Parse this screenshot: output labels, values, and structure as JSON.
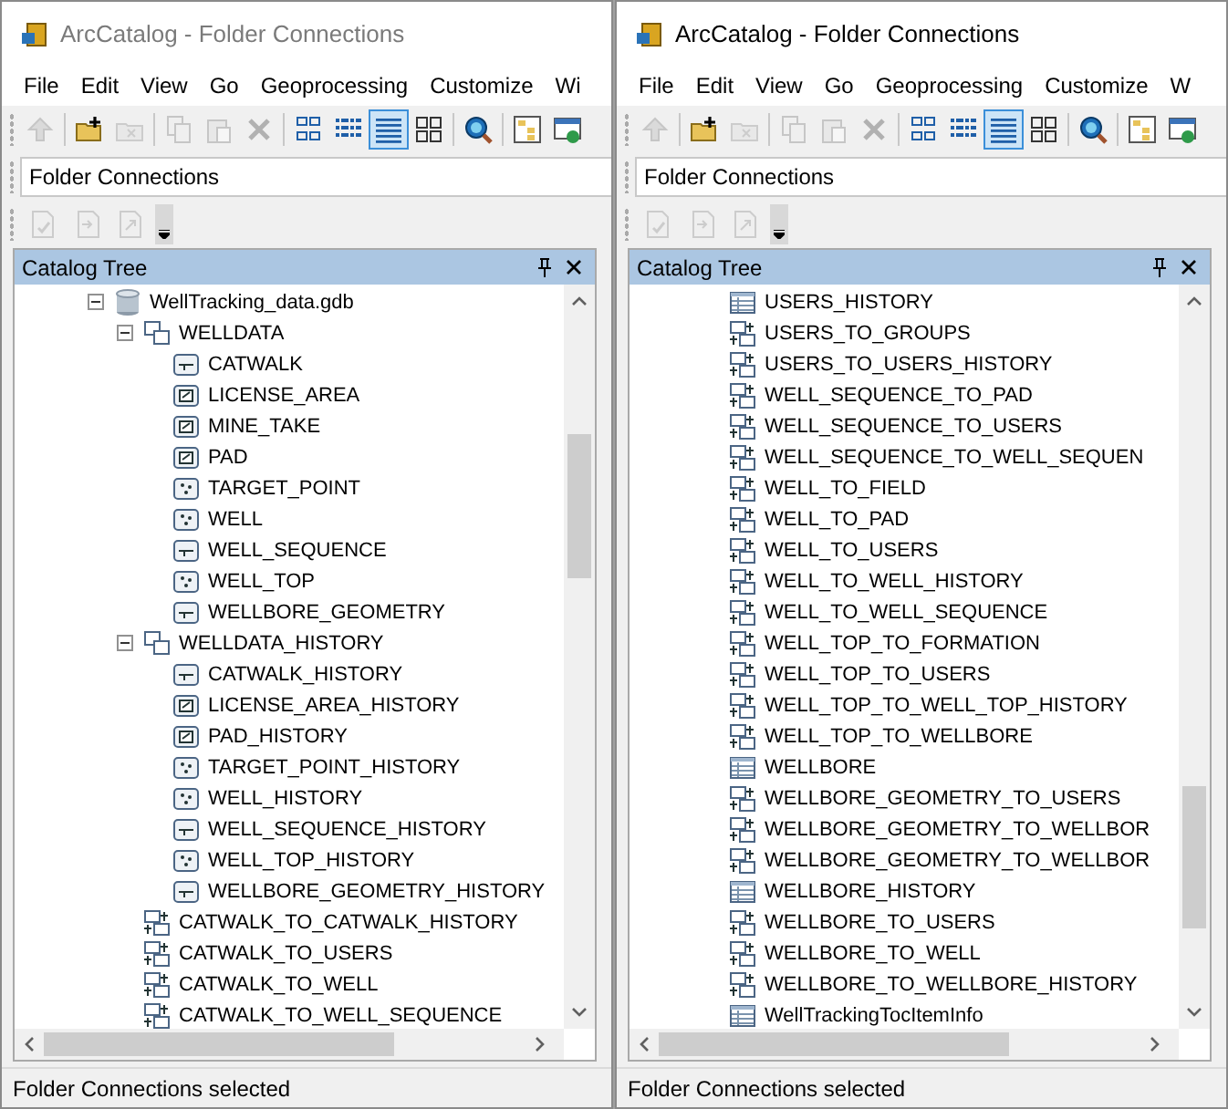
{
  "windows": [
    {
      "title": "ArcCatalog - Folder Connections",
      "active": false,
      "menu": [
        "File",
        "Edit",
        "View",
        "Go",
        "Geoprocessing",
        "Customize",
        "Wi"
      ],
      "toolbar": [
        [
          {
            "kind": "up",
            "disabled": true
          }
        ],
        [
          {
            "kind": "connect",
            "disabled": false
          },
          {
            "kind": "disconnect",
            "disabled": true
          }
        ],
        [
          {
            "kind": "copy",
            "disabled": true
          },
          {
            "kind": "paste",
            "disabled": true
          },
          {
            "kind": "delete",
            "disabled": true
          }
        ],
        [
          {
            "kind": "large-icons",
            "disabled": false,
            "selected": false
          },
          {
            "kind": "list",
            "disabled": false,
            "selected": false
          },
          {
            "kind": "details",
            "disabled": false,
            "selected": true
          },
          {
            "kind": "thumbnails",
            "disabled": false,
            "selected": false
          }
        ],
        [
          {
            "kind": "search",
            "disabled": false
          }
        ],
        [
          {
            "kind": "catalog-tree",
            "disabled": false
          },
          {
            "kind": "window",
            "disabled": false
          }
        ]
      ],
      "location": "Folder Connections",
      "toolbar2": [
        {
          "kind": "validate",
          "disabled": true
        },
        {
          "kind": "import",
          "disabled": true
        },
        {
          "kind": "export",
          "disabled": true
        }
      ],
      "panel_title": "Catalog Tree",
      "tree": [
        {
          "label": "WellTracking_data.gdb",
          "kind": "gdb",
          "expanded": true,
          "children": [
            {
              "label": "WELLDATA",
              "kind": "dataset",
              "expanded": true,
              "children": [
                {
                  "label": "CATWALK",
                  "kind": "line"
                },
                {
                  "label": "LICENSE_AREA",
                  "kind": "polygon"
                },
                {
                  "label": "MINE_TAKE",
                  "kind": "polygon"
                },
                {
                  "label": "PAD",
                  "kind": "polygon"
                },
                {
                  "label": "TARGET_POINT",
                  "kind": "point"
                },
                {
                  "label": "WELL",
                  "kind": "point"
                },
                {
                  "label": "WELL_SEQUENCE",
                  "kind": "line"
                },
                {
                  "label": "WELL_TOP",
                  "kind": "point"
                },
                {
                  "label": "WELLBORE_GEOMETRY",
                  "kind": "line"
                }
              ]
            },
            {
              "label": "WELLDATA_HISTORY",
              "kind": "dataset",
              "expanded": true,
              "children": [
                {
                  "label": "CATWALK_HISTORY",
                  "kind": "line"
                },
                {
                  "label": "LICENSE_AREA_HISTORY",
                  "kind": "polygon"
                },
                {
                  "label": "PAD_HISTORY",
                  "kind": "polygon"
                },
                {
                  "label": "TARGET_POINT_HISTORY",
                  "kind": "point"
                },
                {
                  "label": "WELL_HISTORY",
                  "kind": "point"
                },
                {
                  "label": "WELL_SEQUENCE_HISTORY",
                  "kind": "line"
                },
                {
                  "label": "WELL_TOP_HISTORY",
                  "kind": "point"
                },
                {
                  "label": "WELLBORE_GEOMETRY_HISTORY",
                  "kind": "line"
                }
              ]
            },
            {
              "label": "CATWALK_TO_CATWALK_HISTORY",
              "kind": "relationship"
            },
            {
              "label": "CATWALK_TO_USERS",
              "kind": "relationship"
            },
            {
              "label": "CATWALK_TO_WELL",
              "kind": "relationship"
            },
            {
              "label": "CATWALK_TO_WELL_SEQUENCE",
              "kind": "relationship"
            }
          ]
        }
      ],
      "status": "Folder Connections selected"
    },
    {
      "title": "ArcCatalog - Folder Connections",
      "active": true,
      "menu": [
        "File",
        "Edit",
        "View",
        "Go",
        "Geoprocessing",
        "Customize",
        "W"
      ],
      "toolbar": [
        [
          {
            "kind": "up",
            "disabled": true
          }
        ],
        [
          {
            "kind": "connect",
            "disabled": false
          },
          {
            "kind": "disconnect",
            "disabled": true
          }
        ],
        [
          {
            "kind": "copy",
            "disabled": true
          },
          {
            "kind": "paste",
            "disabled": true
          },
          {
            "kind": "delete",
            "disabled": true
          }
        ],
        [
          {
            "kind": "large-icons",
            "disabled": false,
            "selected": false
          },
          {
            "kind": "list",
            "disabled": false,
            "selected": false
          },
          {
            "kind": "details",
            "disabled": false,
            "selected": true
          },
          {
            "kind": "thumbnails",
            "disabled": false,
            "selected": false
          }
        ],
        [
          {
            "kind": "search",
            "disabled": false
          }
        ],
        [
          {
            "kind": "catalog-tree",
            "disabled": false
          },
          {
            "kind": "window",
            "disabled": false
          }
        ]
      ],
      "location": "Folder Connections",
      "toolbar2": [
        {
          "kind": "validate",
          "disabled": true
        },
        {
          "kind": "import",
          "disabled": true
        },
        {
          "kind": "export",
          "disabled": true
        }
      ],
      "panel_title": "Catalog Tree",
      "tree": [
        {
          "label": "USERS_HISTORY",
          "kind": "table"
        },
        {
          "label": "USERS_TO_GROUPS",
          "kind": "relationship"
        },
        {
          "label": "USERS_TO_USERS_HISTORY",
          "kind": "relationship"
        },
        {
          "label": "WELL_SEQUENCE_TO_PAD",
          "kind": "relationship"
        },
        {
          "label": "WELL_SEQUENCE_TO_USERS",
          "kind": "relationship"
        },
        {
          "label": "WELL_SEQUENCE_TO_WELL_SEQUEN",
          "kind": "relationship"
        },
        {
          "label": "WELL_TO_FIELD",
          "kind": "relationship"
        },
        {
          "label": "WELL_TO_PAD",
          "kind": "relationship"
        },
        {
          "label": "WELL_TO_USERS",
          "kind": "relationship"
        },
        {
          "label": "WELL_TO_WELL_HISTORY",
          "kind": "relationship"
        },
        {
          "label": "WELL_TO_WELL_SEQUENCE",
          "kind": "relationship"
        },
        {
          "label": "WELL_TOP_TO_FORMATION",
          "kind": "relationship"
        },
        {
          "label": "WELL_TOP_TO_USERS",
          "kind": "relationship"
        },
        {
          "label": "WELL_TOP_TO_WELL_TOP_HISTORY",
          "kind": "relationship"
        },
        {
          "label": "WELL_TOP_TO_WELLBORE",
          "kind": "relationship"
        },
        {
          "label": "WELLBORE",
          "kind": "table"
        },
        {
          "label": "WELLBORE_GEOMETRY_TO_USERS",
          "kind": "relationship"
        },
        {
          "label": "WELLBORE_GEOMETRY_TO_WELLBOR",
          "kind": "relationship"
        },
        {
          "label": "WELLBORE_GEOMETRY_TO_WELLBOR",
          "kind": "relationship"
        },
        {
          "label": "WELLBORE_HISTORY",
          "kind": "table"
        },
        {
          "label": "WELLBORE_TO_USERS",
          "kind": "relationship"
        },
        {
          "label": "WELLBORE_TO_WELL",
          "kind": "relationship"
        },
        {
          "label": "WELLBORE_TO_WELLBORE_HISTORY",
          "kind": "relationship"
        },
        {
          "label": "WellTrackingTocItemInfo",
          "kind": "table"
        }
      ],
      "status": "Folder Connections selected"
    }
  ]
}
